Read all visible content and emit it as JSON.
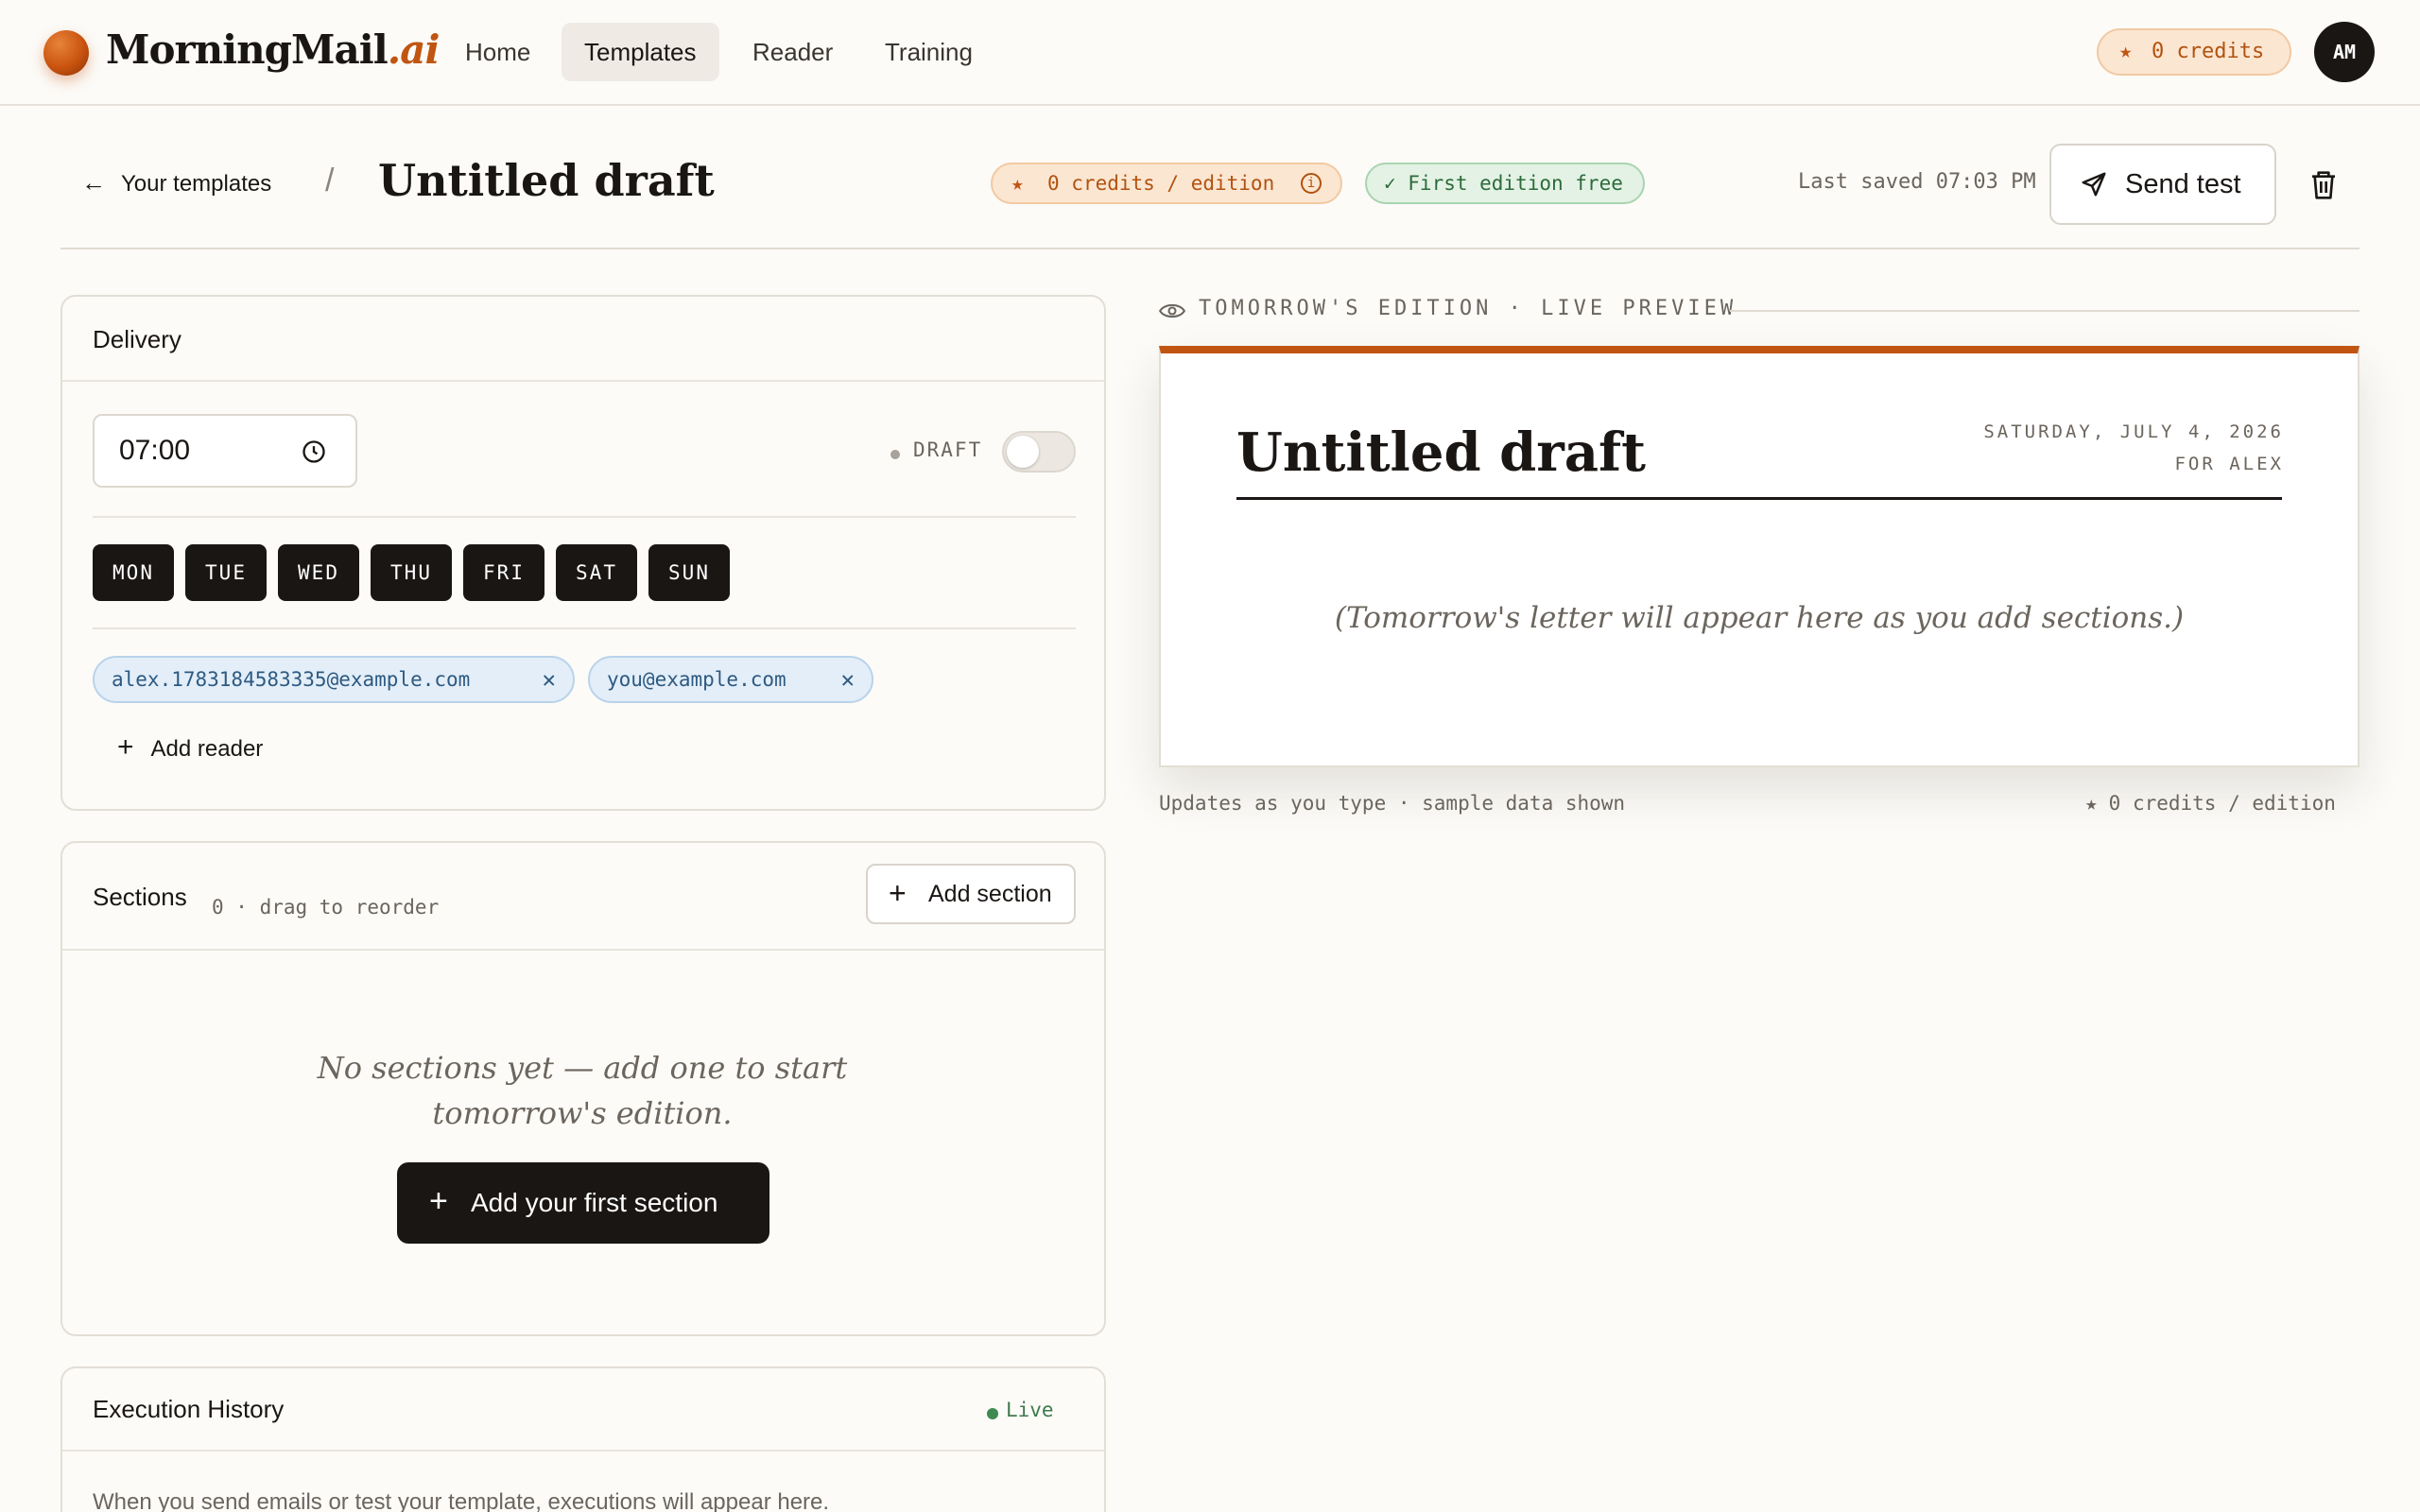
{
  "brand": {
    "name": "MorningMail",
    "suffix": ".ai"
  },
  "nav": [
    {
      "label": "Home"
    },
    {
      "label": "Templates"
    },
    {
      "label": "Reader"
    },
    {
      "label": "Training"
    }
  ],
  "topbar": {
    "credits": "0 credits",
    "avatar_initials": "AM"
  },
  "header": {
    "back_label": "Your templates",
    "separator": "/",
    "title": "Untitled draft",
    "credits_badge": "0 credits / edition",
    "free_badge": "✓ First edition free",
    "last_saved": "Last saved 07:03 PM",
    "send_test": "Send test"
  },
  "delivery": {
    "title": "Delivery",
    "time": "07:00",
    "status": "DRAFT",
    "toggle_on": false,
    "days": [
      "MON",
      "TUE",
      "WED",
      "THU",
      "FRI",
      "SAT",
      "SUN"
    ],
    "readers": [
      "alex.1783184583335@example.com",
      "you@example.com"
    ],
    "add_reader": "Add reader"
  },
  "sections": {
    "title": "Sections",
    "count_hint": "0 · drag to reorder",
    "add_button": "Add section",
    "empty_message": "No sections yet — add one to start tomorrow's edition.",
    "add_first": "Add your first section"
  },
  "execution": {
    "title": "Execution History",
    "status": "Live",
    "message": "When you send emails or test your template, executions will appear here."
  },
  "preview": {
    "label": "TOMORROW'S EDITION · LIVE PREVIEW",
    "title": "Untitled draft",
    "date": "SATURDAY, JULY 4, 2026",
    "for": "FOR ALEX",
    "placeholder": "(Tomorrow's letter will appear here as you add sections.)",
    "footer_left": "Updates as you type · sample data shown",
    "footer_right": "0 credits / edition"
  },
  "colors": {
    "accent": "#c05512",
    "ink": "#1a1614",
    "background": "#fcfbf8",
    "success": "#3f8a52",
    "chip": "#e3eef8"
  }
}
